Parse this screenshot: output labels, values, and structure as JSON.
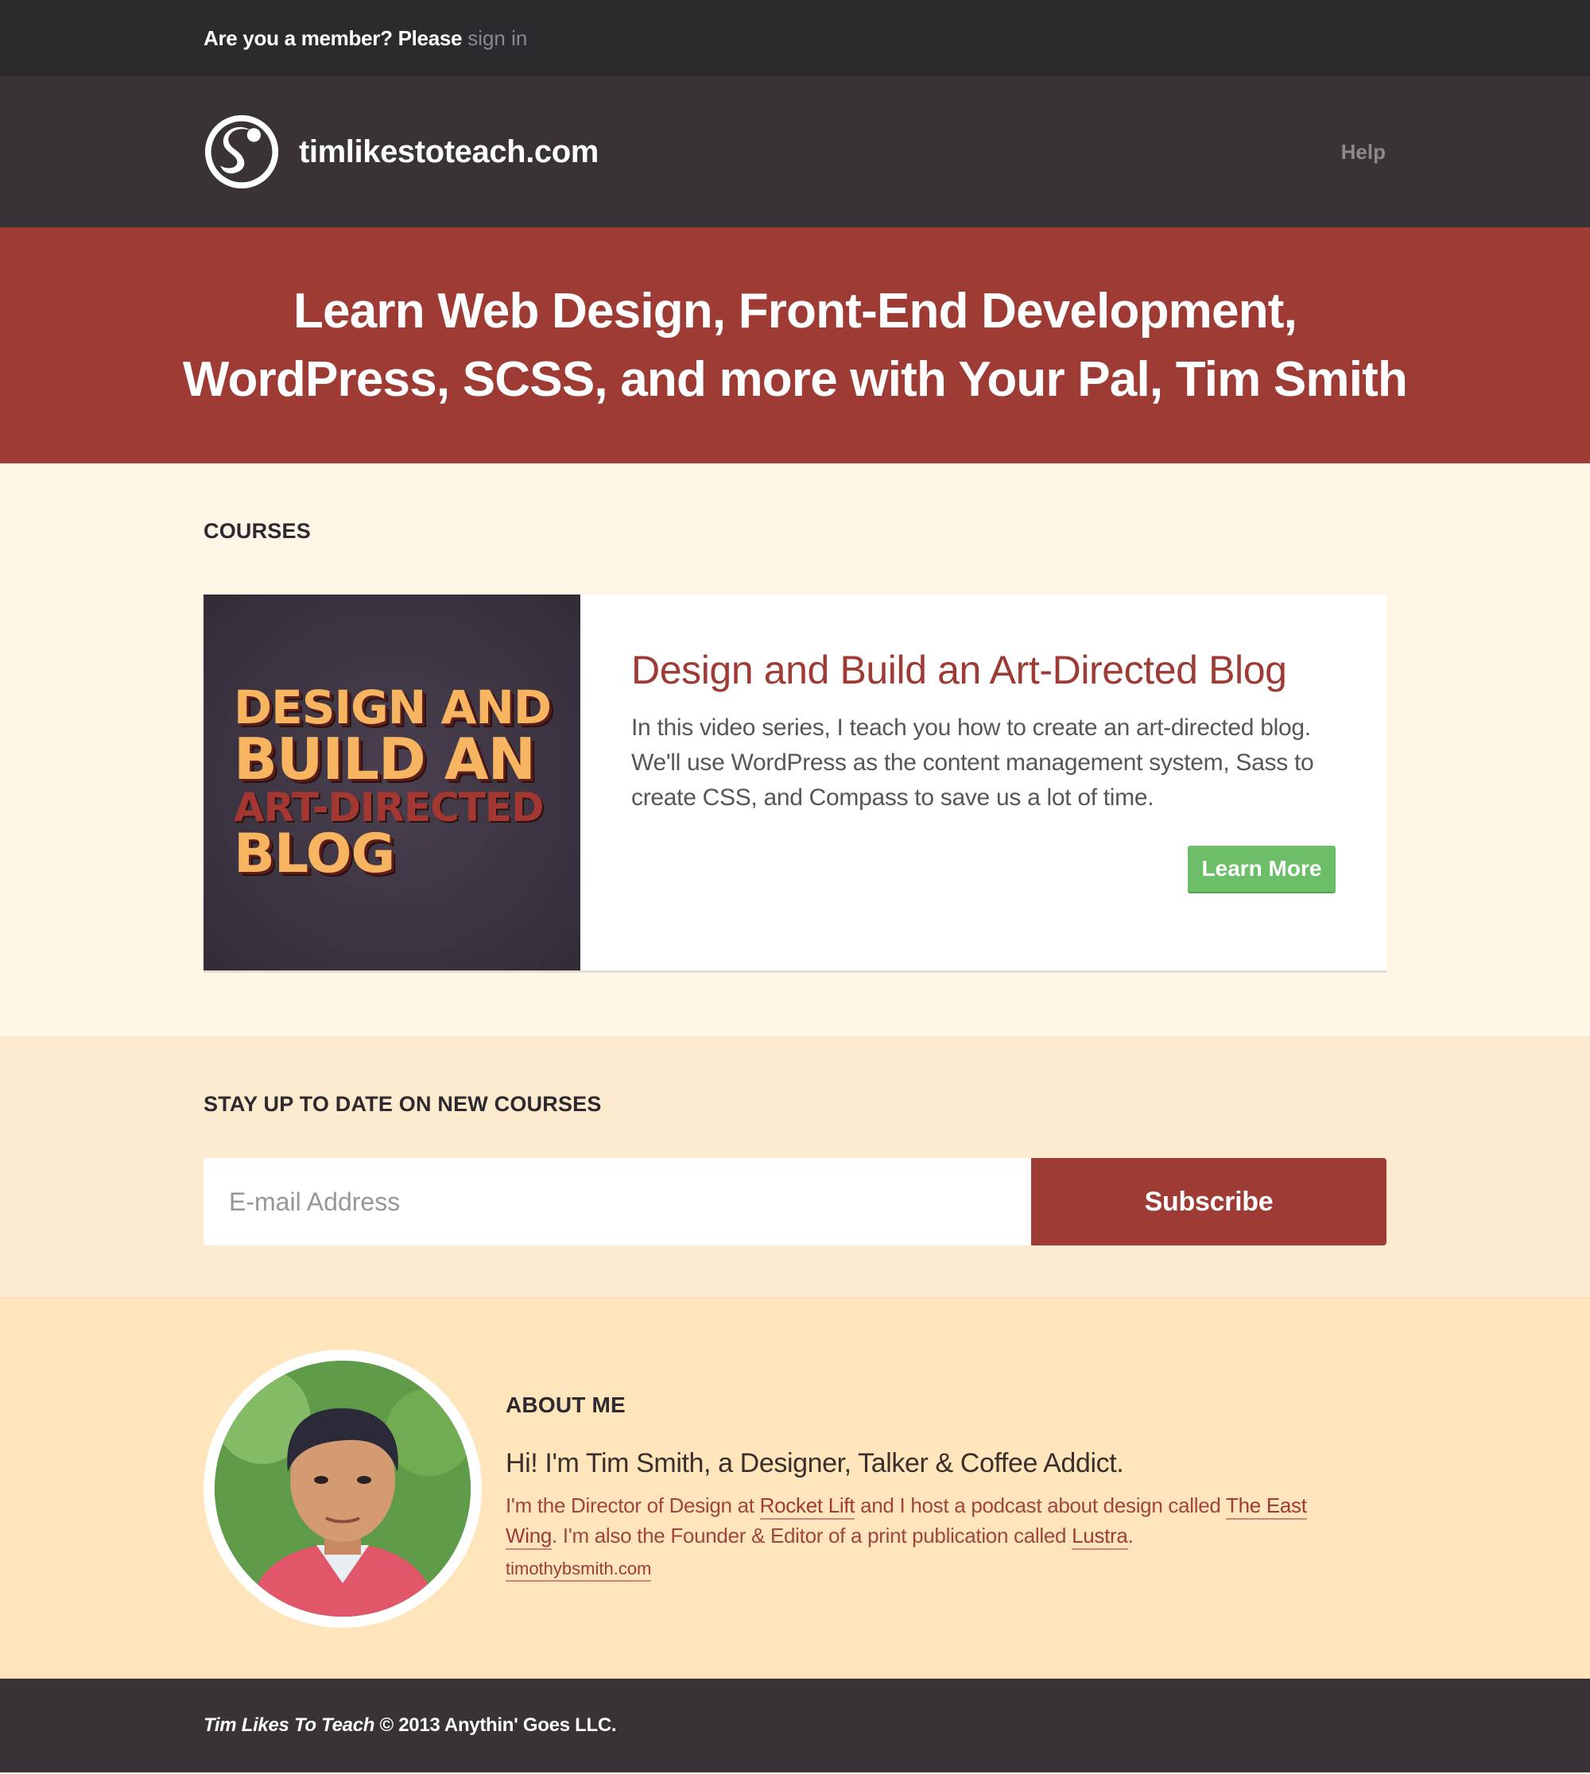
{
  "member_bar": {
    "question": "Are you a member? Please",
    "signin_label": "sign in"
  },
  "header": {
    "site_name": "timlikestoteach.com",
    "help_label": "Help"
  },
  "hero": {
    "line1": "Learn Web Design, Front-End Development,",
    "line2": "WordPress, SCSS, and more with Your Pal, Tim Smith"
  },
  "courses": {
    "section_title": "COURSES",
    "items": [
      {
        "thumb_lines": [
          "DESIGN AND",
          "BUILD AN",
          "ART-DIRECTED",
          "BLOG"
        ],
        "title": "Design and Build an Art-Directed Blog",
        "description": "In this video series, I teach you how to create an art-directed blog. We'll use WordPress as the content management system, Sass to create CSS, and Compass to save us a lot of time.",
        "button_label": "Learn More"
      }
    ]
  },
  "subscribe": {
    "section_title": "STAY UP TO DATE ON NEW COURSES",
    "email_placeholder": "E-mail Address",
    "button_label": "Subscribe"
  },
  "about": {
    "section_title": "ABOUT ME",
    "lead": "Hi! I'm Tim Smith, a Designer, Talker & Coffee Addict.",
    "bio_part1": "I'm the Director of Design at ",
    "bio_link1": "Rocket Lift",
    "bio_part2": " and I host a podcast about design called ",
    "bio_link2": "The East Wing",
    "bio_part3": ". I'm also the Founder & Editor of a print publication called ",
    "bio_link3": "Lustra",
    "bio_part4": ".",
    "website": "timothybsmith.com"
  },
  "footer": {
    "brand": "Tim Likes To Teach",
    "copyright": "© 2013 Anythin' Goes LLC."
  },
  "colors": {
    "dark": "#2d292f",
    "header": "#393338",
    "accent_red": "#9e3b35",
    "cream": "#fff6e8",
    "peach": "#fdebcf",
    "sand": "#fee5bb",
    "green": "#6cbf68"
  }
}
